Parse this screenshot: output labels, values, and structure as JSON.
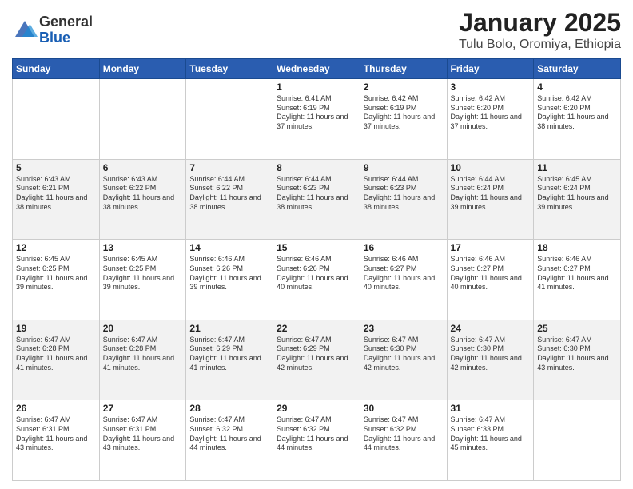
{
  "logo": {
    "general": "General",
    "blue": "Blue"
  },
  "title": "January 2025",
  "location": "Tulu Bolo, Oromiya, Ethiopia",
  "days_of_week": [
    "Sunday",
    "Monday",
    "Tuesday",
    "Wednesday",
    "Thursday",
    "Friday",
    "Saturday"
  ],
  "weeks": [
    [
      {
        "day": "",
        "info": ""
      },
      {
        "day": "",
        "info": ""
      },
      {
        "day": "",
        "info": ""
      },
      {
        "day": "1",
        "info": "Sunrise: 6:41 AM\nSunset: 6:19 PM\nDaylight: 11 hours and 37 minutes."
      },
      {
        "day": "2",
        "info": "Sunrise: 6:42 AM\nSunset: 6:19 PM\nDaylight: 11 hours and 37 minutes."
      },
      {
        "day": "3",
        "info": "Sunrise: 6:42 AM\nSunset: 6:20 PM\nDaylight: 11 hours and 37 minutes."
      },
      {
        "day": "4",
        "info": "Sunrise: 6:42 AM\nSunset: 6:20 PM\nDaylight: 11 hours and 38 minutes."
      }
    ],
    [
      {
        "day": "5",
        "info": "Sunrise: 6:43 AM\nSunset: 6:21 PM\nDaylight: 11 hours and 38 minutes."
      },
      {
        "day": "6",
        "info": "Sunrise: 6:43 AM\nSunset: 6:22 PM\nDaylight: 11 hours and 38 minutes."
      },
      {
        "day": "7",
        "info": "Sunrise: 6:44 AM\nSunset: 6:22 PM\nDaylight: 11 hours and 38 minutes."
      },
      {
        "day": "8",
        "info": "Sunrise: 6:44 AM\nSunset: 6:23 PM\nDaylight: 11 hours and 38 minutes."
      },
      {
        "day": "9",
        "info": "Sunrise: 6:44 AM\nSunset: 6:23 PM\nDaylight: 11 hours and 38 minutes."
      },
      {
        "day": "10",
        "info": "Sunrise: 6:44 AM\nSunset: 6:24 PM\nDaylight: 11 hours and 39 minutes."
      },
      {
        "day": "11",
        "info": "Sunrise: 6:45 AM\nSunset: 6:24 PM\nDaylight: 11 hours and 39 minutes."
      }
    ],
    [
      {
        "day": "12",
        "info": "Sunrise: 6:45 AM\nSunset: 6:25 PM\nDaylight: 11 hours and 39 minutes."
      },
      {
        "day": "13",
        "info": "Sunrise: 6:45 AM\nSunset: 6:25 PM\nDaylight: 11 hours and 39 minutes."
      },
      {
        "day": "14",
        "info": "Sunrise: 6:46 AM\nSunset: 6:26 PM\nDaylight: 11 hours and 39 minutes."
      },
      {
        "day": "15",
        "info": "Sunrise: 6:46 AM\nSunset: 6:26 PM\nDaylight: 11 hours and 40 minutes."
      },
      {
        "day": "16",
        "info": "Sunrise: 6:46 AM\nSunset: 6:27 PM\nDaylight: 11 hours and 40 minutes."
      },
      {
        "day": "17",
        "info": "Sunrise: 6:46 AM\nSunset: 6:27 PM\nDaylight: 11 hours and 40 minutes."
      },
      {
        "day": "18",
        "info": "Sunrise: 6:46 AM\nSunset: 6:27 PM\nDaylight: 11 hours and 41 minutes."
      }
    ],
    [
      {
        "day": "19",
        "info": "Sunrise: 6:47 AM\nSunset: 6:28 PM\nDaylight: 11 hours and 41 minutes."
      },
      {
        "day": "20",
        "info": "Sunrise: 6:47 AM\nSunset: 6:28 PM\nDaylight: 11 hours and 41 minutes."
      },
      {
        "day": "21",
        "info": "Sunrise: 6:47 AM\nSunset: 6:29 PM\nDaylight: 11 hours and 41 minutes."
      },
      {
        "day": "22",
        "info": "Sunrise: 6:47 AM\nSunset: 6:29 PM\nDaylight: 11 hours and 42 minutes."
      },
      {
        "day": "23",
        "info": "Sunrise: 6:47 AM\nSunset: 6:30 PM\nDaylight: 11 hours and 42 minutes."
      },
      {
        "day": "24",
        "info": "Sunrise: 6:47 AM\nSunset: 6:30 PM\nDaylight: 11 hours and 42 minutes."
      },
      {
        "day": "25",
        "info": "Sunrise: 6:47 AM\nSunset: 6:30 PM\nDaylight: 11 hours and 43 minutes."
      }
    ],
    [
      {
        "day": "26",
        "info": "Sunrise: 6:47 AM\nSunset: 6:31 PM\nDaylight: 11 hours and 43 minutes."
      },
      {
        "day": "27",
        "info": "Sunrise: 6:47 AM\nSunset: 6:31 PM\nDaylight: 11 hours and 43 minutes."
      },
      {
        "day": "28",
        "info": "Sunrise: 6:47 AM\nSunset: 6:32 PM\nDaylight: 11 hours and 44 minutes."
      },
      {
        "day": "29",
        "info": "Sunrise: 6:47 AM\nSunset: 6:32 PM\nDaylight: 11 hours and 44 minutes."
      },
      {
        "day": "30",
        "info": "Sunrise: 6:47 AM\nSunset: 6:32 PM\nDaylight: 11 hours and 44 minutes."
      },
      {
        "day": "31",
        "info": "Sunrise: 6:47 AM\nSunset: 6:33 PM\nDaylight: 11 hours and 45 minutes."
      },
      {
        "day": "",
        "info": ""
      }
    ]
  ]
}
